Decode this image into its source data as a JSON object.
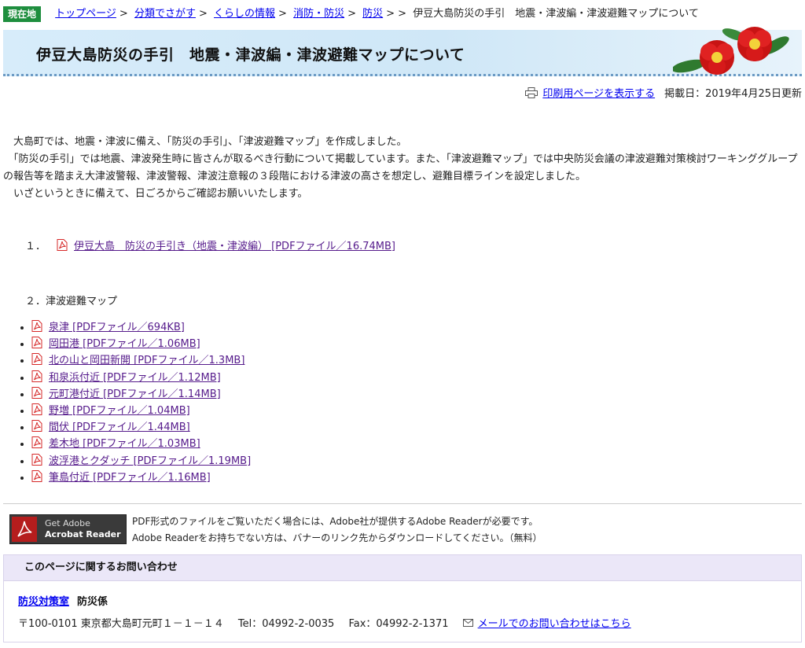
{
  "breadcrumb": {
    "tag": "現在地",
    "links": [
      "トップページ",
      "分類でさがす",
      "くらしの情報",
      "消防・防災",
      "防災"
    ],
    "current": "伊豆大島防災の手引　地震・津波編・津波避難マップについて"
  },
  "page": {
    "title": "伊豆大島防災の手引　地震・津波編・津波避難マップについて",
    "print_label": "印刷用ページを表示する",
    "date": "掲載日：2019年4月25日更新"
  },
  "intro": [
    "　大島町では、地震・津波に備え、「防災の手引」、「津波避難マップ」を作成しました。",
    "　「防災の手引」では地震、津波発生時に皆さんが取るべき行動について掲載しています。また、「津波避難マップ」では中央防災会議の津波避難対策検討ワーキンググループの報告等を踏まえ大津波警報、津波警報、津波注意報の３段階における津波の高さを想定し、避難目標ラインを設定しました。",
    "　いざというときに備えて、日ごろからご確認お願いいたします。"
  ],
  "item1": {
    "num": "１．",
    "link": "伊豆大島　防災の手引き（地震・津波編） [PDFファイル／16.74MB]"
  },
  "item2": {
    "heading": "２．津波避難マップ"
  },
  "maps": [
    "泉津 [PDFファイル／694KB]",
    "岡田港 [PDFファイル／1.06MB]",
    "北の山と岡田新開 [PDFファイル／1.3MB]",
    "和泉浜付近 [PDFファイル／1.12MB]",
    "元町港付近 [PDFファイル／1.14MB]",
    "野増 [PDFファイル／1.04MB]",
    "間伏 [PDFファイル／1.44MB]",
    "差木地 [PDFファイル／1.03MB]",
    "波浮港とクダッチ [PDFファイル／1.19MB]",
    "筆島付近 [PDFファイル／1.16MB]"
  ],
  "adobe": {
    "banner_line1": "Get Adobe",
    "banner_line2": "Acrobat Reader",
    "text1": "PDF形式のファイルをご覧いただく場合には、Adobe社が提供するAdobe Readerが必要です。",
    "text2": "Adobe Readerをお持ちでない方は、バナーのリンク先からダウンロードしてください。（無料）"
  },
  "contact": {
    "heading": "このページに関するお問い合わせ",
    "dept_link": "防災対策室",
    "dept_sub": "防災係",
    "address": "〒100-0101 東京都大島町元町１－１－１４",
    "tel": "Tel：04992-2-0035",
    "fax": "Fax：04992-2-1371",
    "mail_link": "メールでのお問い合わせはこちら"
  },
  "colors": {
    "link": "#0000ee",
    "visited": "#551a8b",
    "tag_bg": "#1e8e3e",
    "banner_bg": "#d7ecfa",
    "contact_head_bg": "#ebe7f8",
    "pdf_red": "#d62828"
  }
}
